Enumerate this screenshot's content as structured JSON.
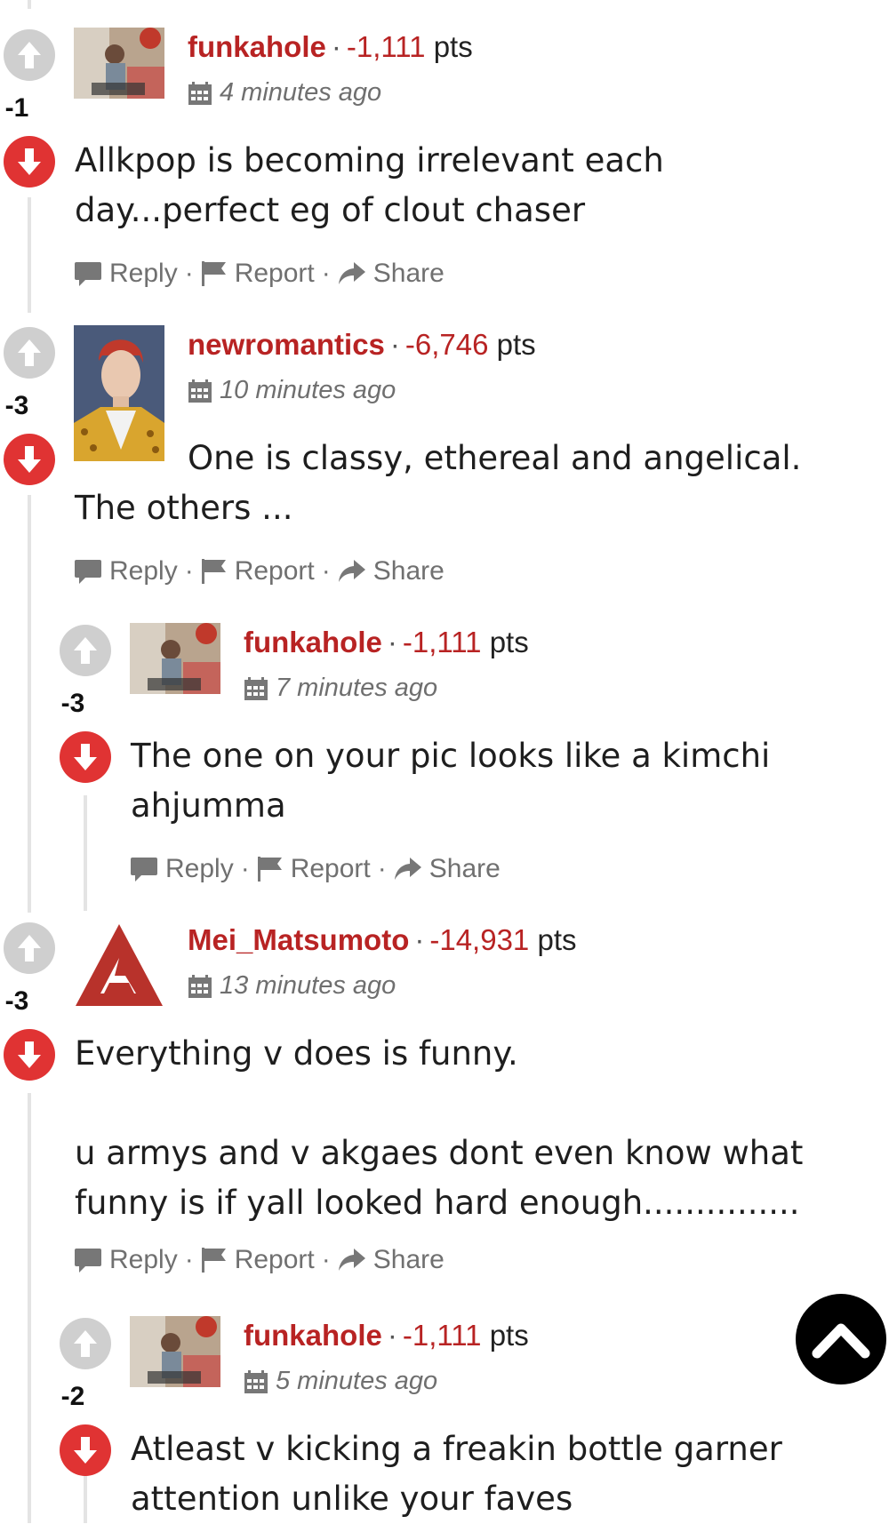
{
  "colors": {
    "username": "#b82323",
    "downvote": "#e03333",
    "upvote": "#cfcfcf",
    "meta": "#6f6f6f"
  },
  "actions": {
    "reply": "Reply",
    "report": "Report",
    "share": "Share",
    "separator": "·"
  },
  "pts_label": "pts",
  "comments": [
    {
      "user": "funkahole",
      "points": "-1,111",
      "time": "4 minutes ago",
      "score": "-1",
      "body": [
        "Allkpop is becoming irrelevant each",
        "day...perfect eg of clout chaser"
      ]
    },
    {
      "user": "newromantics",
      "points": "-6,746",
      "time": "10 minutes ago",
      "score": "-3",
      "body": [
        "One is classy, ethereal and angelical.",
        "The others ..."
      ]
    },
    {
      "user": "funkahole",
      "points": "-1,111",
      "time": "7 minutes ago",
      "score": "-3",
      "body": [
        "The one on your pic looks like a kimchi",
        "ahjumma"
      ]
    },
    {
      "user": "Mei_Matsumoto",
      "points": "-14,931",
      "time": "13 minutes ago",
      "score": "-3",
      "body": [
        "Everything v does is funny.",
        "",
        "u armys and v akgaes dont even know what",
        "funny is if yall looked hard enough..............."
      ]
    },
    {
      "user": "funkahole",
      "points": "-1,111",
      "time": "5 minutes ago",
      "score": "-2",
      "body": [
        "Atleast v kicking a freakin bottle garner",
        "attention unlike your faves"
      ]
    }
  ]
}
